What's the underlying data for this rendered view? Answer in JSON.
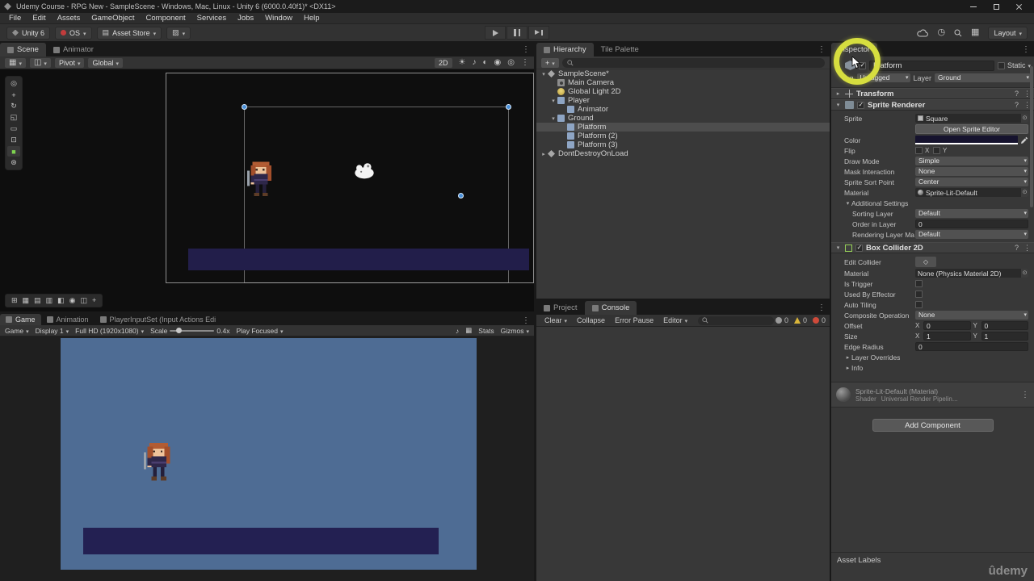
{
  "window": {
    "title": "Udemy Course - RPG New - SampleScene - Windows, Mac, Linux - Unity 6 (6000.0.40f1)* <DX11>"
  },
  "menu": {
    "items": [
      "File",
      "Edit",
      "Assets",
      "GameObject",
      "Component",
      "Services",
      "Jobs",
      "Window",
      "Help"
    ]
  },
  "toolbar": {
    "unity_badge": "Unity 6",
    "os_label": "OS",
    "asset_store": "Asset Store",
    "layout": "Layout"
  },
  "scene": {
    "tab_scene": "Scene",
    "tab_animator": "Animator",
    "pivot": "Pivot",
    "global_label": "Global",
    "mode_2d": "2D"
  },
  "hierarchy": {
    "tab_hierarchy": "Hierarchy",
    "tab_tile_palette": "Tile Palette",
    "add_label": "+",
    "items": [
      {
        "label": "SampleScene*"
      },
      {
        "label": "Main Camera"
      },
      {
        "label": "Global Light 2D"
      },
      {
        "label": "Player"
      },
      {
        "label": "Animator"
      },
      {
        "label": "Ground"
      },
      {
        "label": "Platform"
      },
      {
        "label": "Platform (2)"
      },
      {
        "label": "Platform (3)"
      },
      {
        "label": "DontDestroyOnLoad"
      }
    ]
  },
  "game": {
    "tab_game": "Game",
    "tab_animation": "Animation",
    "tab_input": "PlayerInputSet (Input Actions Edi",
    "mode": "Game",
    "display": "Display 1",
    "resolution": "Full HD (1920x1080)",
    "scale_label": "Scale",
    "scale_value": "0.4x",
    "play_focused": "Play Focused",
    "stats_label": "Stats",
    "gizmos_label": "Gizmos"
  },
  "console": {
    "tab_project": "Project",
    "tab_console": "Console",
    "clear_label": "Clear",
    "collapse_label": "Collapse",
    "error_pause_label": "Error Pause",
    "editor_label": "Editor",
    "info_count": "0",
    "warning_count": "0",
    "error_count": "0"
  },
  "inspector": {
    "tab": "Inspector",
    "header": {
      "name": "Platform",
      "static_label": "Static",
      "tag_label": "Tag",
      "tag_value": "Untagged",
      "layer_label": "Layer",
      "layer_value": "Ground"
    },
    "transform": {
      "title": "Transform"
    },
    "sprite_renderer": {
      "title": "Sprite Renderer",
      "sprite_label": "Sprite",
      "sprite_value": "Square",
      "open_sprite_editor": "Open Sprite Editor",
      "color_label": "Color",
      "flip_label": "Flip",
      "x_label": "X",
      "y_label": "Y",
      "draw_mode_label": "Draw Mode",
      "draw_mode_value": "Simple",
      "mask_interaction_label": "Mask Interaction",
      "mask_interaction_value": "None",
      "sort_point_label": "Sprite Sort Point",
      "sort_point_value": "Center",
      "material_label": "Material",
      "material_value": "Sprite-Lit-Default",
      "additional_settings_label": "Additional Settings",
      "sorting_layer_label": "Sorting Layer",
      "sorting_layer_value": "Default",
      "order_in_layer_label": "Order in Layer",
      "order_in_layer_value": "0",
      "rendering_layer_label": "Rendering Layer Ma",
      "rendering_layer_value": "Default"
    },
    "box_collider": {
      "title": "Box Collider 2D",
      "edit_collider_label": "Edit Collider",
      "material_label": "Material",
      "material_value": "None (Physics Material 2D)",
      "is_trigger_label": "Is Trigger",
      "used_by_effector_label": "Used By Effector",
      "auto_tiling_label": "Auto Tiling",
      "composite_label": "Composite Operation",
      "composite_value": "None",
      "offset_label": "Offset",
      "size_label": "Size",
      "edge_radius_label": "Edge Radius",
      "x_label": "X",
      "y_label": "Y",
      "offset_x": "0",
      "offset_y": "0",
      "size_x": "1",
      "size_y": "1",
      "edge_radius_value": "0",
      "layer_overrides_label": "Layer Overrides",
      "info_label": "Info"
    },
    "material_preview": {
      "title": "Sprite-Lit-Default (Material)",
      "shader_label": "Shader",
      "shader_value": "Universal Render Pipelin..."
    },
    "add_component_label": "Add Component",
    "asset_labels": "Asset Labels"
  },
  "annotation": {
    "highlight_color": "#d6de3f"
  },
  "watermark": "ûdemy",
  "icons": {
    "menu": "⋮",
    "history": "◷",
    "layers": "▦",
    "store": "▤",
    "paint": "▨",
    "grid": "▦",
    "magnet": "◫",
    "audio": "♪",
    "contrast": "◐",
    "sun": "☀",
    "camera": "◉",
    "eye": "◎",
    "expanded": "▾",
    "collapsed": "▸",
    "help": "?",
    "edit_collider": "◇",
    "tools": [
      "◎",
      "+",
      "↻",
      "◱",
      "▭",
      "⊡",
      "■",
      "⊛"
    ],
    "overlay": [
      "⊞",
      "▦",
      "▤",
      "▥",
      "◧",
      "◉",
      "◫",
      "+"
    ]
  },
  "colors": {
    "annotation": "#d6de3f",
    "platform": "#221e4a",
    "game_background": "#4e6c94",
    "selection_handle": "#4a90d9"
  }
}
